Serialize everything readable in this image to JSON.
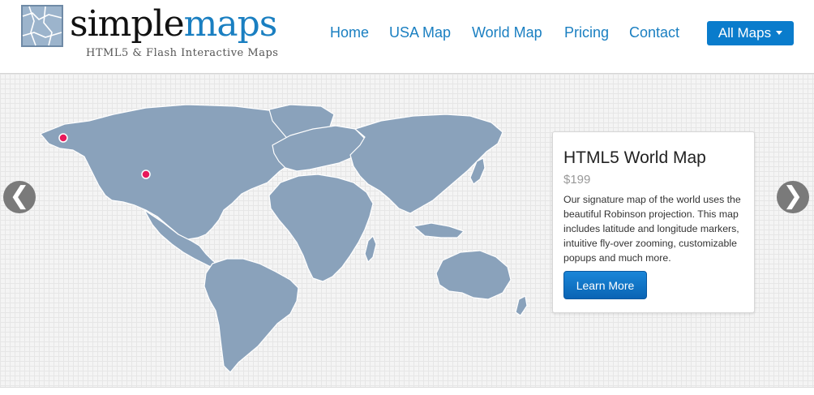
{
  "brand": {
    "name_part1": "simple",
    "name_part2": "maps",
    "tagline": "HTML5 & Flash Interactive Maps",
    "colors": {
      "primary": "#1a7fc1",
      "button": "#0a7ccc",
      "land": "#8aa2bb",
      "marker": "#e8195b"
    }
  },
  "nav": {
    "items": [
      {
        "label": "Home"
      },
      {
        "label": "USA Map"
      },
      {
        "label": "World Map"
      },
      {
        "label": "Pricing"
      },
      {
        "label": "Contact"
      }
    ],
    "dropdown_label": "All Maps"
  },
  "slider": {
    "prev_icon": "❮",
    "next_icon": "❯"
  },
  "product": {
    "title": "HTML5 World Map",
    "price": "$199",
    "description": "Our signature map of the world uses the beautiful Robinson projection. This map includes latitude and longitude markers, intuitive fly-over zooming, customizable popups and much more.",
    "button_label": "Learn More"
  }
}
